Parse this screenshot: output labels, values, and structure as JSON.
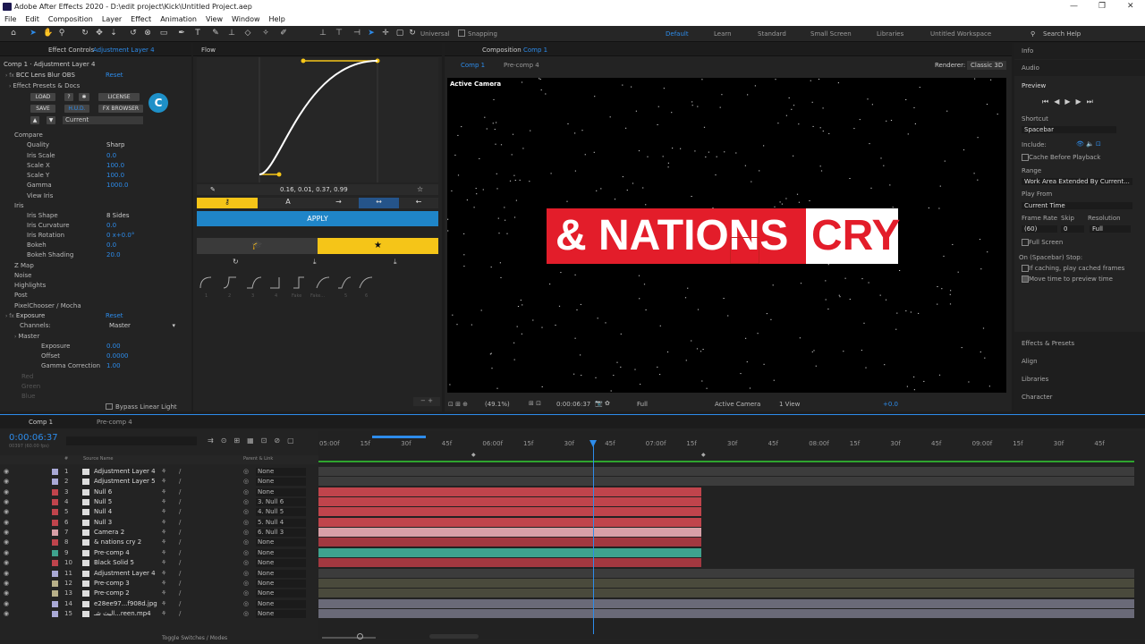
{
  "window": {
    "title": "Adobe After Effects 2020 - D:\\edit project\\Kick\\Untitled Project.aep",
    "minimize": "—",
    "maximize": "❐",
    "close": "✕"
  },
  "menu": [
    "File",
    "Edit",
    "Composition",
    "Layer",
    "Effect",
    "Animation",
    "View",
    "Window",
    "Help"
  ],
  "toolbar": {
    "universal": "Universal",
    "snapping": "Snapping",
    "workspaces": [
      "Default",
      "Learn",
      "Standard",
      "Small Screen",
      "Libraries",
      "Untitled Workspace"
    ],
    "search_placeholder": "Search Help"
  },
  "effect_controls": {
    "tab_label": "Effect Controls",
    "tab_layer": "Adjustment Layer 4",
    "subtitle": "Comp 1 · Adjustment Layer 4",
    "fx1_name": "BCC Lens Blur OBS",
    "reset": "Reset",
    "presets_label": "Effect Presets & Docs",
    "load": "LOAD",
    "q": "?",
    "gear": "✱",
    "license": "LICENSE",
    "save": "SAVE",
    "hud": "H.U.D.",
    "fx_browser": "FX BROWSER",
    "current": "Current",
    "params": [
      {
        "name": "Compare",
        "value": ""
      },
      {
        "name": "Quality",
        "value": "Sharp"
      },
      {
        "name": "Iris Scale",
        "value": "0.0"
      },
      {
        "name": "Scale X",
        "value": "100.0"
      },
      {
        "name": "Scale Y",
        "value": "100.0"
      },
      {
        "name": "Gamma",
        "value": "1000.0"
      },
      {
        "name": "View Iris",
        "value": ""
      },
      {
        "name": "Iris",
        "value": ""
      },
      {
        "name": "Iris Shape",
        "value": "8 Sides"
      },
      {
        "name": "Iris Curvature",
        "value": "0.0"
      },
      {
        "name": "Iris Rotation",
        "value": "0 x+0.0°"
      },
      {
        "name": "Bokeh",
        "value": "0.0"
      },
      {
        "name": "Bokeh Shading",
        "value": "20.0"
      },
      {
        "name": "Z Map",
        "value": ""
      },
      {
        "name": "Noise",
        "value": ""
      },
      {
        "name": "Highlights",
        "value": ""
      },
      {
        "name": "Post",
        "value": ""
      },
      {
        "name": "PixelChooser / Mocha",
        "value": ""
      }
    ],
    "fx2_name": "Exposure",
    "channels_label": "Channels:",
    "channels_value": "Master",
    "master": "Master",
    "exposure_params": [
      {
        "name": "Exposure",
        "value": "0.00"
      },
      {
        "name": "Offset",
        "value": "0.0000"
      },
      {
        "name": "Gamma Correction",
        "value": "1.00"
      }
    ],
    "red": "Red",
    "green": "Green",
    "blue": "Blue",
    "bypass": "Bypass Linear Light"
  },
  "flow": {
    "tab": "Flow",
    "values": "0.16, 0.01, 0.37, 0.99",
    "apply": "APPLY",
    "hints": [
      "1",
      "2",
      "3",
      "4",
      "Fake",
      "Fake...",
      "5",
      "6"
    ]
  },
  "composition": {
    "tab": "Composition",
    "tab_comp": "Comp 1",
    "subtabs": [
      "Comp 1",
      "Pre-comp 4"
    ],
    "renderer_label": "Renderer:",
    "renderer": "Classic 3D",
    "camera_label": "Active Camera",
    "title_red": "& NATIONS",
    "title_white": "CRY",
    "footer": {
      "zoom": "(49.1%)",
      "timecode": "0:00:06:37",
      "res": "Full",
      "camera": "Active Camera",
      "view": "1 View",
      "offset": "+0.0"
    }
  },
  "right_panels": {
    "info": "Info",
    "audio": "Audio",
    "preview": "Preview",
    "shortcut_label": "Shortcut",
    "shortcut": "Spacebar",
    "include": "Include:",
    "cache_before": "Cache Before Playback",
    "range_label": "Range",
    "range": "Work Area Extended By Current...",
    "play_from_label": "Play From",
    "play_from": "Current Time",
    "frame_rate_label": "Frame Rate",
    "skip_label": "Skip",
    "resolution_label": "Resolution",
    "frame_rate": "(60)",
    "skip": "0",
    "resolution": "Full",
    "full_screen": "Full Screen",
    "on_stop": "On (Spacebar) Stop:",
    "if_caching": "If caching, play cached frames",
    "move_time": "Move time to preview time",
    "effects_presets": "Effects & Presets",
    "align": "Align",
    "libraries": "Libraries",
    "character": "Character"
  },
  "timeline": {
    "tab_comp1": "Comp 1",
    "tab_precomp": "Pre-comp 4",
    "timecode": "0:00:06:37",
    "frames": "00397 (60.00 fps)",
    "search_placeholder": "",
    "header": {
      "num": "#",
      "source": "Source Name",
      "parent": "Parent & Link"
    },
    "ruler": [
      "05:00f",
      "15f",
      "30f",
      "45f",
      "06:00f",
      "15f",
      "30f",
      "45f",
      "07:00f",
      "15f",
      "30f",
      "45f",
      "08:00f",
      "15f",
      "30f",
      "45f",
      "09:00f",
      "15f",
      "30f",
      "45f"
    ],
    "layers": [
      {
        "n": "1",
        "name": "Adjustment Layer 4",
        "parent": "None",
        "color": "#a9a9d6"
      },
      {
        "n": "2",
        "name": "Adjustment Layer 5",
        "parent": "None",
        "color": "#a9a9d6"
      },
      {
        "n": "3",
        "name": "Null 6",
        "parent": "None",
        "color": "#c0444c"
      },
      {
        "n": "4",
        "name": "Null 5",
        "parent": "3. Null 6",
        "color": "#c0444c"
      },
      {
        "n": "5",
        "name": "Null 4",
        "parent": "4. Null 5",
        "color": "#c0444c"
      },
      {
        "n": "6",
        "name": "Null 3",
        "parent": "5. Null 4",
        "color": "#c0444c"
      },
      {
        "n": "7",
        "name": "Camera 2",
        "parent": "6. Null 3",
        "color": "#d8a0a8"
      },
      {
        "n": "8",
        "name": "& nations cry 2",
        "parent": "None",
        "color": "#c0444c"
      },
      {
        "n": "9",
        "name": "Pre-comp 4",
        "parent": "None",
        "color": "#3ea38e"
      },
      {
        "n": "10",
        "name": "Black Solid 5",
        "parent": "None",
        "color": "#c0444c"
      },
      {
        "n": "11",
        "name": "Adjustment Layer 4",
        "parent": "None",
        "color": "#a9a9d6"
      },
      {
        "n": "12",
        "name": "Pre-comp 3",
        "parent": "None",
        "color": "#b8b089"
      },
      {
        "n": "13",
        "name": "Pre-comp 2",
        "parent": "None",
        "color": "#b8b089"
      },
      {
        "n": "14",
        "name": "e28ee97...f908d.jpg",
        "parent": "None",
        "color": "#a9a9d6"
      },
      {
        "n": "15",
        "name": "البث شـ...reen.mp4",
        "parent": "None",
        "color": "#a9a9d6"
      }
    ],
    "toggle": "Toggle Switches / Modes"
  }
}
